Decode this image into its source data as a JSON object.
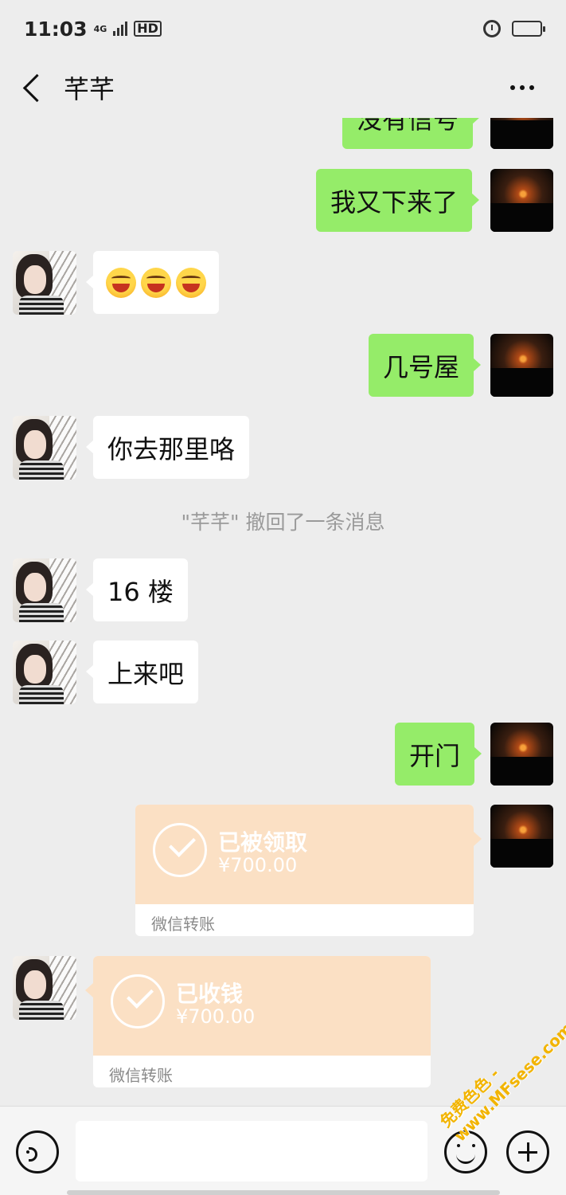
{
  "status_bar": {
    "time": "11:03",
    "network": "4G",
    "hd_label": "HD",
    "battery_level": 0.3
  },
  "header": {
    "title": "芊芊"
  },
  "messages": [
    {
      "side": "self",
      "text": "没有信号"
    },
    {
      "side": "self",
      "text": "我又下来了"
    },
    {
      "side": "other",
      "emoji": [
        "laughing-squint-face",
        "laughing-squint-face",
        "laughing-squint-face"
      ]
    },
    {
      "side": "self",
      "text": "几号屋"
    },
    {
      "side": "other",
      "text": "你去那里咯"
    },
    {
      "type": "system",
      "text": "\"芊芊\" 撤回了一条消息"
    },
    {
      "side": "other",
      "text": "16 楼"
    },
    {
      "side": "other",
      "text": "上来吧"
    },
    {
      "side": "self",
      "text": "开门"
    },
    {
      "side": "self",
      "type": "transfer",
      "status": "已被领取",
      "amount": "¥700.00",
      "label": "微信转账"
    },
    {
      "side": "other",
      "type": "transfer",
      "status": "已收钱",
      "amount": "¥700.00",
      "label": "微信转账"
    }
  ],
  "input_bar": {
    "placeholder": ""
  },
  "watermark": {
    "line1": "免费色色 -",
    "line2": "www.MFsese.com"
  },
  "colors": {
    "self_bubble": "#95ec69",
    "other_bubble": "#ffffff",
    "transfer_card": "#fbe0c4",
    "background": "#ededed"
  }
}
